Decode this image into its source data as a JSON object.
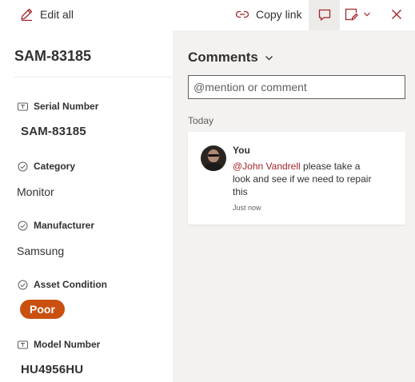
{
  "toolbar": {
    "edit_all_label": "Edit all",
    "copy_link_label": "Copy link",
    "icons": {
      "edit": "pencil-icon",
      "link": "link-icon",
      "comment": "comment-icon",
      "form": "form-edit-icon",
      "chevron": "chevron-down-icon",
      "close": "close-icon"
    },
    "close_color": "#a4262c"
  },
  "item": {
    "title": "SAM-83185",
    "fields": [
      {
        "label": "Serial Number",
        "value": "SAM-83185",
        "icon": "text-field-icon"
      },
      {
        "label": "Category",
        "value": "Monitor",
        "icon": "choice-check-icon"
      },
      {
        "label": "Manufacturer",
        "value": "Samsung",
        "icon": "choice-check-icon"
      },
      {
        "label": "Asset Condition",
        "value": "Poor",
        "icon": "choice-check-icon",
        "pill_color": "#ca5010"
      },
      {
        "label": "Model Number",
        "value": "HU4956HU",
        "icon": "text-field-icon"
      }
    ]
  },
  "comments": {
    "header": "Comments",
    "input_placeholder": "@mention or comment",
    "group_label": "Today",
    "list": [
      {
        "author": "You",
        "mention": "@John Vandrell",
        "text": " please take a look and see if we need to repair this",
        "timestamp": "Just now"
      }
    ]
  }
}
